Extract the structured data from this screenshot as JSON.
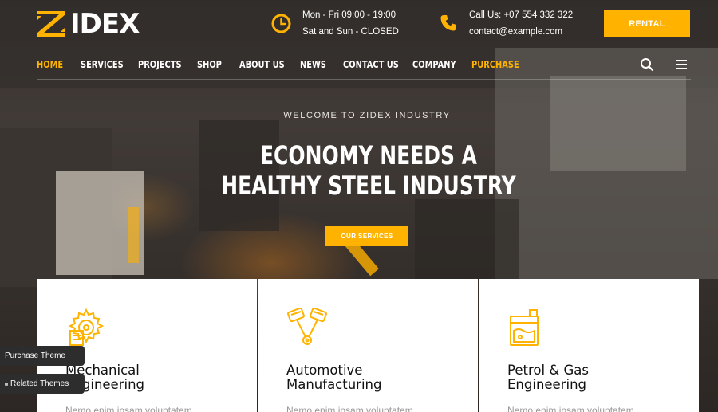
{
  "brand": {
    "name": "IDEX",
    "accent_color": "#ffb300"
  },
  "header": {
    "hours": {
      "icon": "clock-icon",
      "line1": "Mon - Fri 09:00 - 19:00",
      "line2": "Sat and Sun - CLOSED"
    },
    "contact": {
      "icon": "phone-icon",
      "line1": "Call Us: +07 554 332 322",
      "line2": "contact@example.com"
    },
    "cta_label": "RENTAL"
  },
  "nav": {
    "items": [
      {
        "label": "HOME"
      },
      {
        "label": "SERVICES"
      },
      {
        "label": "PROJECTS"
      },
      {
        "label": "SHOP"
      },
      {
        "label": "ABOUT US"
      },
      {
        "label": "NEWS"
      },
      {
        "label": "CONTACT US"
      },
      {
        "label": "COMPANY"
      },
      {
        "label": "PURCHASE"
      }
    ],
    "search_icon": "search-icon",
    "menu_icon": "hamburger-menu-icon"
  },
  "hero": {
    "welcome": "WELCOME TO ZIDEX INDUSTRY",
    "headline_line1": "ECONOMY NEEDS A",
    "headline_line2": "HEALTHY STEEL INDUSTRY",
    "button_label": "OUR SERVICES"
  },
  "cards": [
    {
      "icon": "gear-document-icon",
      "title_line1": "Mechanical",
      "title_line2": "Engineering",
      "text": "Nemo enim ipsam voluptatem"
    },
    {
      "icon": "piston-icon",
      "title_line1": "Automotive",
      "title_line2": "Manufacturing",
      "text": "Nemo enim ipsam voluptatem"
    },
    {
      "icon": "oil-canister-icon",
      "title_line1": "Petrol & Gas",
      "title_line2": "Engineering",
      "text": "Nemo enim ipsam voluptatem"
    }
  ],
  "side_tags": {
    "purchase": "Purchase Theme",
    "related": "Related Themes"
  }
}
